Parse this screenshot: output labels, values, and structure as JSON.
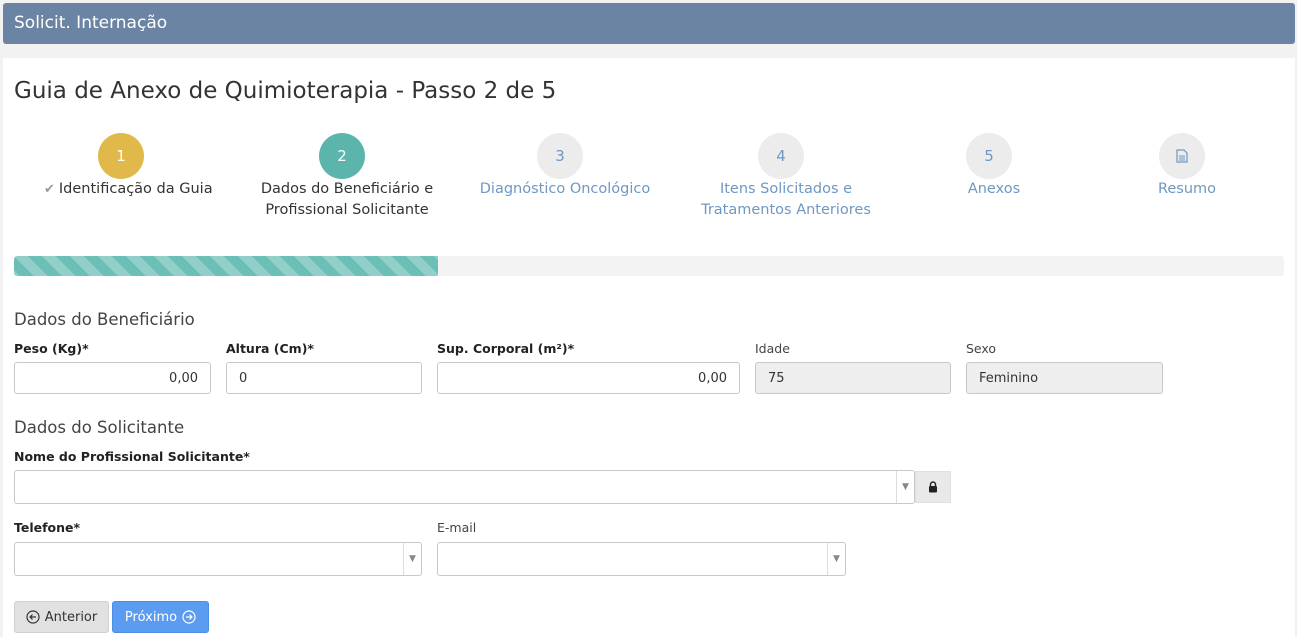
{
  "header": {
    "title": "Solicit. Internação"
  },
  "page": {
    "title": "Guia de Anexo de Quimioterapia - Passo 2 de 5"
  },
  "wizard": {
    "steps": [
      {
        "number": "1",
        "label_line1": "Identificação da Guia",
        "label_line2": "",
        "state": "done"
      },
      {
        "number": "2",
        "label_line1": "Dados do Beneficiário e",
        "label_line2": "Profissional Solicitante",
        "state": "active"
      },
      {
        "number": "3",
        "label_line1": "Diagnóstico Oncológico",
        "label_line2": "",
        "state": "todo"
      },
      {
        "number": "4",
        "label_line1": "Itens Solicitados e",
        "label_line2": "Tratamentos Anteriores",
        "state": "todo"
      },
      {
        "number": "5",
        "label_line1": "Anexos",
        "label_line2": "",
        "state": "todo"
      },
      {
        "number": "",
        "icon": "document-icon",
        "label_line1": "Resumo",
        "label_line2": "",
        "state": "todo"
      }
    ],
    "progress_fraction": 0.334
  },
  "beneficiario": {
    "section_title": "Dados do Beneficiário",
    "peso": {
      "label": "Peso (Kg)*",
      "value": "0,00"
    },
    "altura": {
      "label": "Altura (Cm)*",
      "value": "0"
    },
    "sup_corporal": {
      "label": "Sup. Corporal (m²)*",
      "value": "0,00"
    },
    "idade": {
      "label": "Idade",
      "value": "75"
    },
    "sexo": {
      "label": "Sexo",
      "value": "Feminino"
    }
  },
  "solicitante": {
    "section_title": "Dados do Solicitante",
    "nome": {
      "label": "Nome do Profissional Solicitante*",
      "value": ""
    },
    "telefone": {
      "label": "Telefone*",
      "value": ""
    },
    "email": {
      "label": "E-mail",
      "value": ""
    }
  },
  "actions": {
    "prev_label": "Anterior",
    "next_label": "Próximo"
  },
  "colors": {
    "header": "#6b84a3",
    "step_done": "#e0b94a",
    "step_active": "#5bb5ac",
    "link": "#6e98c2",
    "primary": "#5b9cf0"
  }
}
